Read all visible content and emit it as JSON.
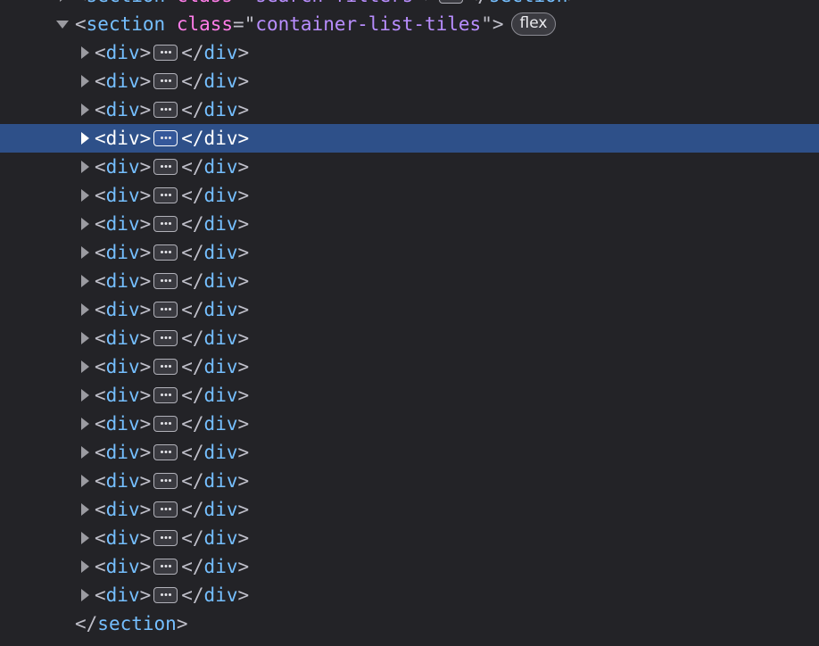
{
  "theme": {
    "background": "#232327",
    "selected_row": "#2e5089",
    "tag_color": "#75bfff",
    "attr_name_color": "#ff7de9",
    "attr_value_color": "#b98eff",
    "punctuation_color": "#bfbfc9"
  },
  "top_row": {
    "tag": "section",
    "attr_name": "class",
    "attr_value": "search-filters",
    "closing_tag": "section"
  },
  "section": {
    "tag": "section",
    "attr_name": "class",
    "attr_value": "container-list-tiles",
    "badge": "flex",
    "closing_tag": "section"
  },
  "children": [
    {
      "tag": "div",
      "closing_tag": "div",
      "selected": false
    },
    {
      "tag": "div",
      "closing_tag": "div",
      "selected": false
    },
    {
      "tag": "div",
      "closing_tag": "div",
      "selected": false
    },
    {
      "tag": "div",
      "closing_tag": "div",
      "selected": true
    },
    {
      "tag": "div",
      "closing_tag": "div",
      "selected": false
    },
    {
      "tag": "div",
      "closing_tag": "div",
      "selected": false
    },
    {
      "tag": "div",
      "closing_tag": "div",
      "selected": false
    },
    {
      "tag": "div",
      "closing_tag": "div",
      "selected": false
    },
    {
      "tag": "div",
      "closing_tag": "div",
      "selected": false
    },
    {
      "tag": "div",
      "closing_tag": "div",
      "selected": false
    },
    {
      "tag": "div",
      "closing_tag": "div",
      "selected": false
    },
    {
      "tag": "div",
      "closing_tag": "div",
      "selected": false
    },
    {
      "tag": "div",
      "closing_tag": "div",
      "selected": false
    },
    {
      "tag": "div",
      "closing_tag": "div",
      "selected": false
    },
    {
      "tag": "div",
      "closing_tag": "div",
      "selected": false
    },
    {
      "tag": "div",
      "closing_tag": "div",
      "selected": false
    },
    {
      "tag": "div",
      "closing_tag": "div",
      "selected": false
    },
    {
      "tag": "div",
      "closing_tag": "div",
      "selected": false
    },
    {
      "tag": "div",
      "closing_tag": "div",
      "selected": false
    },
    {
      "tag": "div",
      "closing_tag": "div",
      "selected": false
    }
  ],
  "icons": {
    "expand": "expand-arrow-icon",
    "collapse": "collapse-arrow-icon",
    "ellipsis": "ellipsis-button"
  }
}
